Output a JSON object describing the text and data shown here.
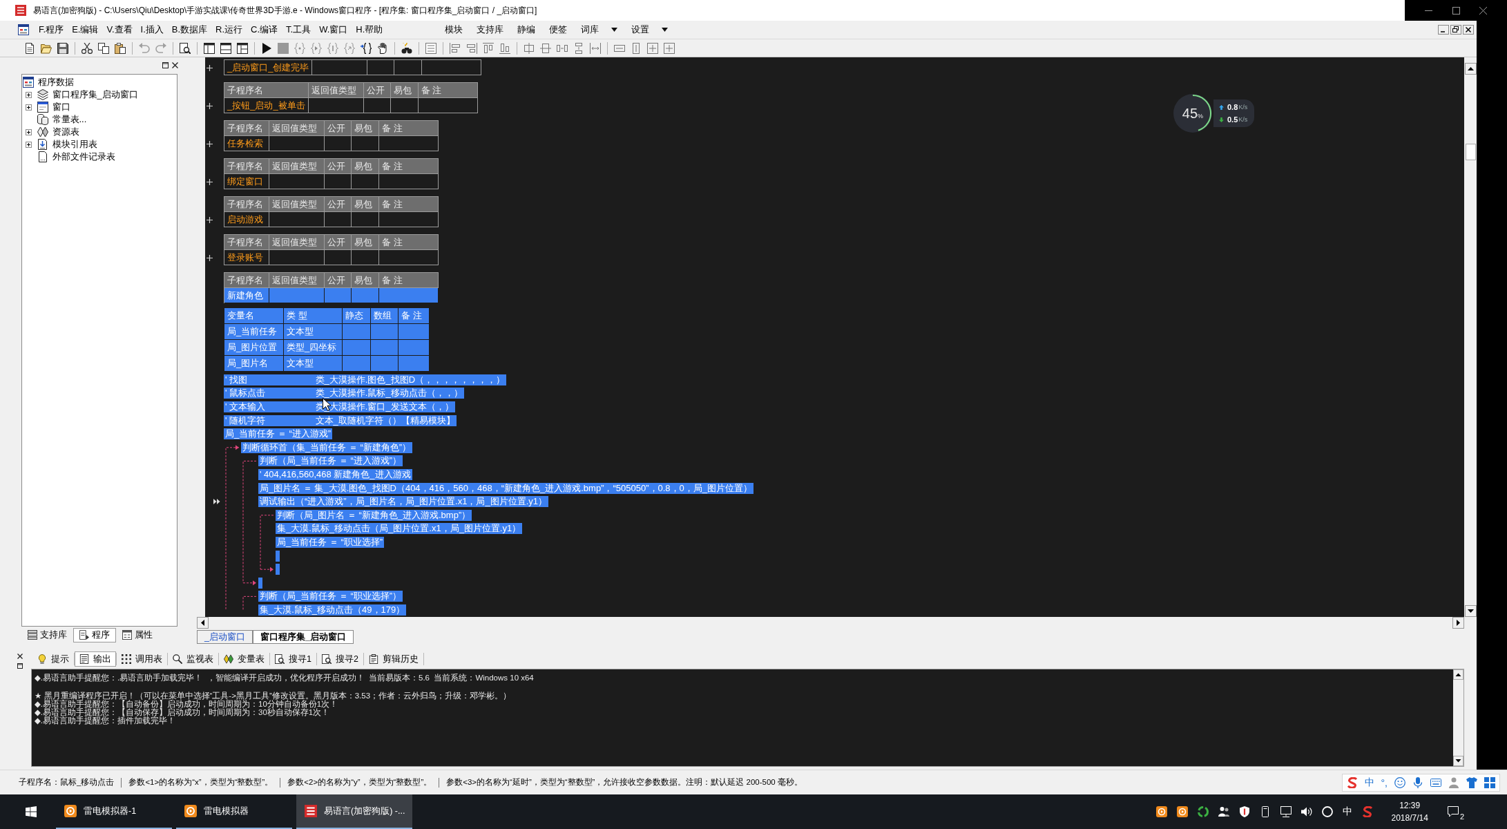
{
  "window": {
    "title": "易语言(加密狗版) - C:\\Users\\Qiu\\Desktop\\手游实战课\\传奇世界3D手游.e - Windows窗口程序 - [程序集: 窗口程序集_启动窗口 / _启动窗口]"
  },
  "menu": {
    "items": [
      "F.程序",
      "E.编辑",
      "V.查看",
      "I.插入",
      "B.数据库",
      "R.运行",
      "C.编译",
      "T.工具",
      "W.窗口",
      "H.帮助"
    ],
    "extra": [
      {
        "label": "模块",
        "dropdown": false
      },
      {
        "label": "支持库",
        "dropdown": false
      },
      {
        "label": "静编",
        "dropdown": false
      },
      {
        "label": "便签",
        "dropdown": false
      },
      {
        "label": "词库",
        "dropdown": true
      },
      {
        "label": "设置",
        "dropdown": true
      }
    ]
  },
  "project_tree": [
    {
      "label": "程序数据",
      "kind": "program",
      "children": [
        {
          "label": "窗口程序集_启动窗口",
          "kind": "class",
          "expanded": false
        },
        {
          "label": "窗口",
          "kind": "window",
          "expanded": false
        },
        {
          "label": "常量表...",
          "kind": "constants"
        },
        {
          "label": "资源表",
          "kind": "resources",
          "expanded": false
        },
        {
          "label": "模块引用表",
          "kind": "modules",
          "expanded": false
        },
        {
          "label": "外部文件记录表",
          "kind": "files"
        }
      ]
    }
  ],
  "panel_tabs": [
    {
      "label": "支持库",
      "kind": "library",
      "selected": false
    },
    {
      "label": "程序",
      "kind": "program",
      "selected": true
    },
    {
      "label": "属性",
      "kind": "properties",
      "selected": false
    }
  ],
  "subroutines": [
    {
      "name": "_启动窗口_创建完毕",
      "expanded": false,
      "selected": false
    },
    {
      "header": [
        "子程序名",
        "返回值类型",
        "公开",
        "易包",
        "备 注"
      ],
      "name": "_按钮_启动_被单击",
      "expanded": false,
      "selected": false
    },
    {
      "header": [
        "子程序名",
        "返回值类型",
        "公开",
        "易包",
        "备 注"
      ],
      "name": "任务检索",
      "expanded": false,
      "selected": false
    },
    {
      "header": [
        "子程序名",
        "返回值类型",
        "公开",
        "易包",
        "备 注"
      ],
      "name": "绑定窗口",
      "expanded": false,
      "selected": false
    },
    {
      "header": [
        "子程序名",
        "返回值类型",
        "公开",
        "易包",
        "备 注"
      ],
      "name": "启动游戏",
      "expanded": false,
      "selected": false
    },
    {
      "header": [
        "子程序名",
        "返回值类型",
        "公开",
        "易包",
        "备 注"
      ],
      "name": "登录账号",
      "expanded": false,
      "selected": false
    },
    {
      "header": [
        "子程序名",
        "返回值类型",
        "公开",
        "易包",
        "备 注"
      ],
      "name": "新建角色",
      "expanded": true,
      "selected": true,
      "variables": {
        "header": [
          "变量名",
          "类 型",
          "静态",
          "数组",
          "备 注"
        ],
        "rows": [
          {
            "name": "局_当前任务",
            "type": "文本型"
          },
          {
            "name": "局_图片位置",
            "type": "类型_四坐标"
          },
          {
            "name": "局_图片名",
            "type": "文本型"
          }
        ]
      },
      "code": [
        {
          "kind": "comment",
          "text": "' 找图",
          "detail": "类_大漠操作.图色_找图D（，，，，，，，，）",
          "current": false
        },
        {
          "kind": "comment",
          "text": "' 鼠标点击",
          "detail": "类_大漠操作.鼠标_移动点击（，，）",
          "current": false
        },
        {
          "kind": "comment",
          "text": "' 文本输入",
          "detail": "类_大漠操作.窗口_发送文本（，）",
          "current": false
        },
        {
          "kind": "comment",
          "text": "' 随机字符",
          "detail": "文本_取随机字符（）【精易模块】",
          "current": false
        },
        {
          "kind": "statement",
          "text": "局_当前任务 ＝ “进入游戏”",
          "current": false
        },
        {
          "kind": "loop",
          "text": "判断循环首（集_当前任务 ＝ “新建角色”）",
          "current": false,
          "children": [
            {
              "kind": "if",
              "text": "判断（局_当前任务 ＝ “进入游戏”）",
              "current": false,
              "children": [
                {
                  "kind": "comment",
                  "text": "' 404,416,560,468 新建角色_进入游戏",
                  "current": false
                },
                {
                  "kind": "statement",
                  "text": "局_图片名 ＝ 集_大漠.图色_找图D（404，416，560，468，“新建角色_进入游戏.bmp”，“505050”，0.8，0，局_图片位置）",
                  "current": false
                },
                {
                  "kind": "statement",
                  "text": "调试输出（“进入游戏”，局_图片名，局_图片位置.x1，局_图片位置.y1）",
                  "current": true
                },
                {
                  "kind": "if",
                  "text": "判断（局_图片名 ＝ “新建角色_进入游戏.bmp”）",
                  "current": false,
                  "children": [
                    {
                      "kind": "statement",
                      "text": "集_大漠.鼠标_移动点击（局_图片位置.x1，局_图片位置.y1）",
                      "current": false
                    },
                    {
                      "kind": "statement",
                      "text": "局_当前任务 ＝ “职业选择”",
                      "current": false
                    },
                    {
                      "kind": "empty",
                      "current": false
                    }
                  ],
                  "else": [
                    {
                      "kind": "empty",
                      "current": false
                    }
                  ]
                }
              ],
              "else": [
                {
                  "kind": "empty",
                  "current": false
                }
              ]
            },
            {
              "kind": "if",
              "text": "判断（局_当前任务 ＝ “职业选择”）",
              "current": false,
              "children": [
                {
                  "kind": "statement",
                  "text": "集_大漠.鼠标_移动点击（49，179）",
                  "current": false
                }
              ]
            }
          ]
        }
      ]
    }
  ],
  "net_monitor": {
    "reading": "45",
    "unit": "%",
    "level": 0.45,
    "upload": {
      "value": "0.8",
      "unit": "K/s"
    },
    "download": {
      "value": "0.5",
      "unit": "K/s"
    }
  },
  "doc_tabs": [
    {
      "label": "_启动窗口",
      "selected": false
    },
    {
      "label": "窗口程序集_启动窗口",
      "selected": true
    }
  ],
  "output_tabs": [
    {
      "label": "提示",
      "kind": "hint",
      "selected": false
    },
    {
      "label": "输出",
      "kind": "output",
      "selected": true
    },
    {
      "label": "调用表",
      "kind": "calls",
      "selected": false
    },
    {
      "label": "监视表",
      "kind": "watch",
      "selected": false
    },
    {
      "label": "变量表",
      "kind": "variables",
      "selected": false
    },
    {
      "label": "搜寻1",
      "kind": "search",
      "selected": false
    },
    {
      "label": "搜寻2",
      "kind": "search",
      "selected": false
    },
    {
      "label": "剪辑历史",
      "kind": "clipboard",
      "selected": false
    }
  ],
  "output_blocks": [
    [
      "◆.易语言助手提醒您：.易语言助手加载完毕！  ，智能编译开启成功，优化程序开启成功！  当前易版本：5.6  当前系统：Windows 10 x64"
    ],
    [
      "★ 黑月重编译程序已开启！（可以在菜单中选择“工具->黑月工具”修改设置。黑月版本：3.53；作者：云外归鸟；升级：邓学彬。）",
      "◆.易语言助手提醒您：【自动备份】启动成功，时间周期为：10分钟自动备份1次！",
      "◆.易语言助手提醒您：【自动保存】启动成功，时间周期为：30秒自动保存1次！",
      "◆.易语言助手提醒您：插件加载完毕！"
    ]
  ],
  "status_bar": [
    "子程序名：鼠标_移动点击",
    "参数<1>的名称为“x”，类型为“整数型”。",
    "参数<2>的名称为“y”，类型为“整数型”。",
    "参数<3>的名称为“延时”，类型为“整数型”，允许接收空参数数据。注明：默认延迟 200-500 毫秒。"
  ],
  "ime_bar": [
    "中",
    "°,"
  ],
  "taskbar": {
    "buttons": [
      {
        "label": "雷电模拟器-1",
        "kind": "emulator",
        "active": false
      },
      {
        "label": "雷电模拟器",
        "kind": "emulator",
        "active": false
      },
      {
        "label": "易语言(加密狗版) -...",
        "kind": "ide",
        "active": true
      }
    ],
    "input_method": "中",
    "time": "12:39",
    "date": "2018/7/14",
    "notifications": "2"
  }
}
